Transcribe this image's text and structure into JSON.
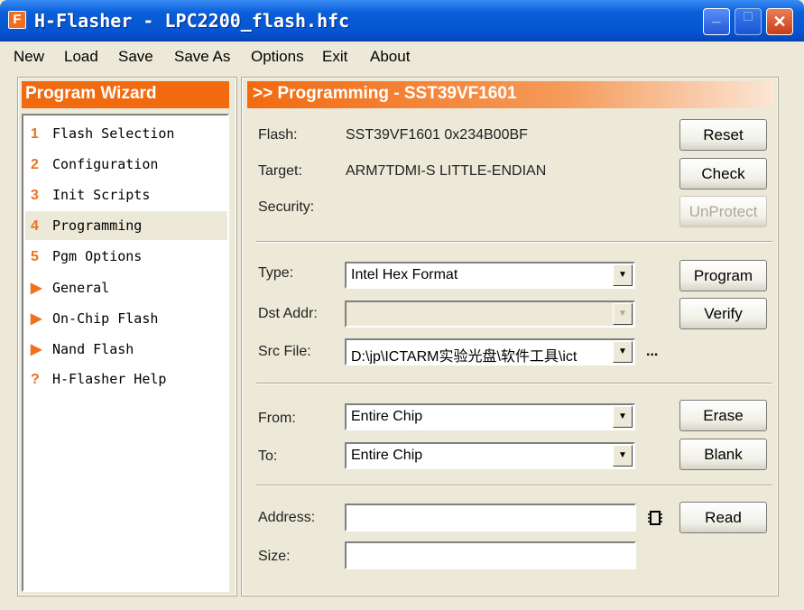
{
  "window": {
    "title": "H-Flasher - LPC2200_flash.hfc",
    "minimize": "_",
    "maximize": "□",
    "close": "✕",
    "app_icon": "F"
  },
  "menu": [
    "New",
    "Load",
    "Save",
    "Save As",
    "Options",
    "Exit",
    "About"
  ],
  "wizard": {
    "title": "Program Wizard",
    "items": [
      {
        "badge": "1",
        "label": "Flash Selection"
      },
      {
        "badge": "2",
        "label": "Configuration"
      },
      {
        "badge": "3",
        "label": "Init Scripts"
      },
      {
        "badge": "4",
        "label": "Programming",
        "selected": true
      },
      {
        "badge": "5",
        "label": "Pgm Options"
      },
      {
        "badge": "▶",
        "label": "General"
      },
      {
        "badge": "▶",
        "label": "On-Chip Flash"
      },
      {
        "badge": "▶",
        "label": "Nand Flash"
      },
      {
        "badge": "?",
        "label": "H-Flasher Help"
      }
    ]
  },
  "main": {
    "title": ">> Programming - SST39VF1601",
    "flash_label": "Flash:",
    "flash_value": "SST39VF1601  0x234B00BF",
    "target_label": "Target:",
    "target_value": "ARM7TDMI-S  LITTLE-ENDIAN",
    "security_label": "Security:",
    "reset": "Reset",
    "check": "Check",
    "unprotect": "UnProtect",
    "type_label": "Type:",
    "type_value": "Intel Hex Format",
    "dst_label": "Dst Addr:",
    "dst_value": "",
    "src_label": "Src File:",
    "src_value": "D:\\jp\\ICTARM实验光盘\\软件工具\\ict",
    "browse": "...",
    "program": "Program",
    "verify": "Verify",
    "from_label": "From:",
    "from_value": "Entire Chip",
    "to_label": "To:",
    "to_value": "Entire Chip",
    "erase": "Erase",
    "blank": "Blank",
    "address_label": "Address:",
    "address_value": "",
    "size_label": "Size:",
    "size_value": "",
    "read": "Read"
  },
  "colors": {
    "accent": "#f26a10",
    "titlebar": "#0a5fd8"
  }
}
